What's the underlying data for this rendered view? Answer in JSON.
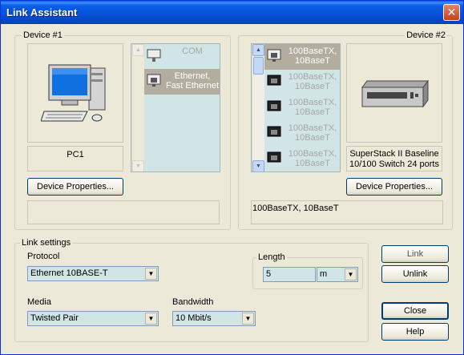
{
  "window": {
    "title": "Link Assistant",
    "close_glyph": "✕"
  },
  "device1": {
    "group_label": "Device #1",
    "name": "PC1",
    "properties_button": "Device Properties...",
    "description": "",
    "ports": [
      {
        "label": "COM",
        "selected": false,
        "icon": "serial-port-icon"
      },
      {
        "label": "Ethernet, Fast Ethernet",
        "selected": true,
        "icon": "ethernet-port-icon"
      }
    ]
  },
  "device2": {
    "group_label": "Device #2",
    "name": "SuperStack II Baseline 10/100 Switch 24 ports",
    "properties_button": "Device Properties...",
    "description": "100BaseTX, 10BaseT",
    "ports": [
      {
        "label": "100BaseTX, 10BaseT",
        "selected": true
      },
      {
        "label": "100BaseTX, 10BaseT",
        "selected": false
      },
      {
        "label": "100BaseTX, 10BaseT",
        "selected": false
      },
      {
        "label": "100BaseTX, 10BaseT",
        "selected": false
      },
      {
        "label": "100BaseTX, 10BaseT",
        "selected": false
      }
    ]
  },
  "link_settings": {
    "group_label": "Link settings",
    "protocol_label": "Protocol",
    "protocol_value": "Ethernet 10BASE-T",
    "media_label": "Media",
    "media_value": "Twisted Pair",
    "bandwidth_label": "Bandwidth",
    "bandwidth_value": "10 Mbit/s",
    "length_group_label": "Length",
    "length_value": "5",
    "length_unit": "m"
  },
  "buttons": {
    "link": "Link",
    "unlink": "Unlink",
    "close": "Close",
    "help": "Help"
  },
  "colors": {
    "list_bg": "#d1e4e6",
    "selected_bg": "#b3ad9f",
    "title_bar": "#0a5fe8",
    "dialog_bg": "#ece9d8"
  }
}
